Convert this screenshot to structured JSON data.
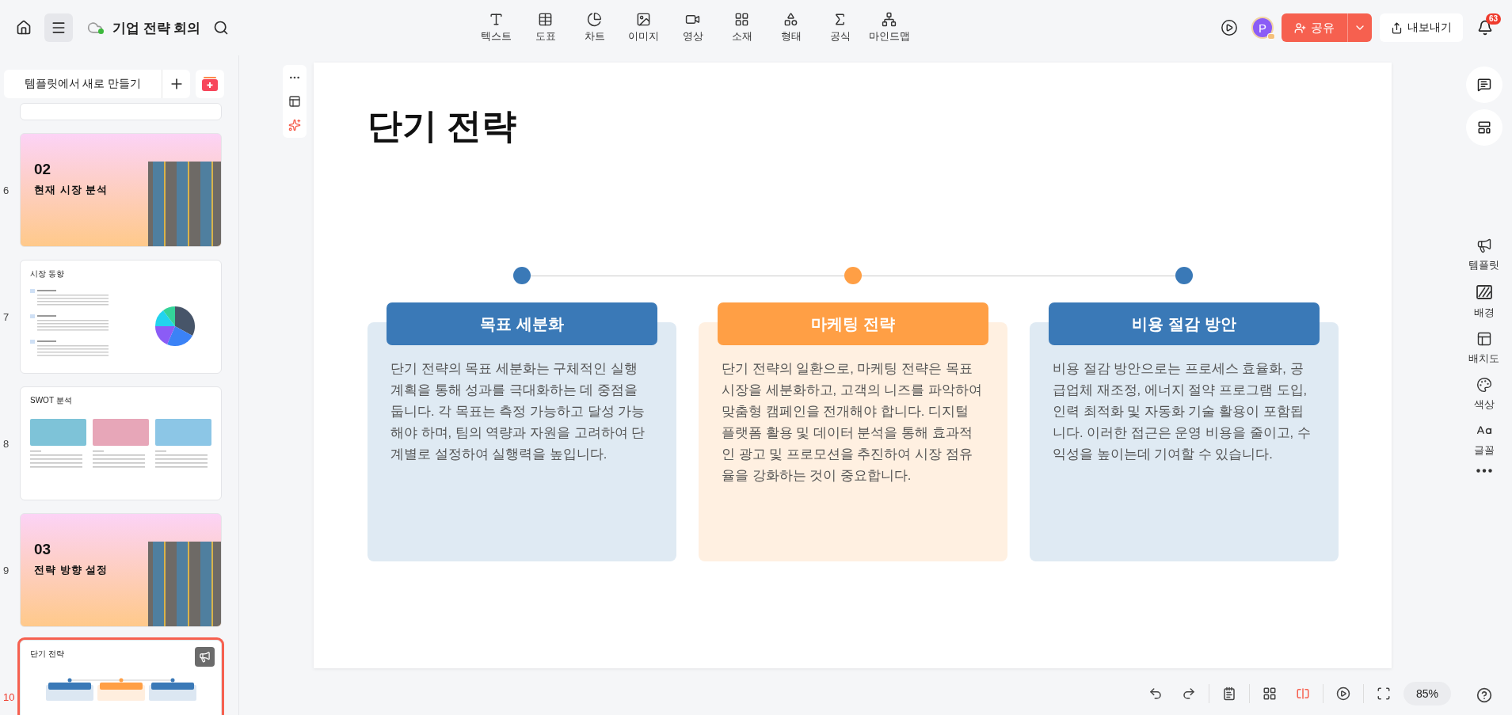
{
  "header": {
    "title": "기업 전략 회의",
    "tools": [
      {
        "label": "텍스트"
      },
      {
        "label": "도표"
      },
      {
        "label": "차트"
      },
      {
        "label": "이미지"
      },
      {
        "label": "영상"
      },
      {
        "label": "소재"
      },
      {
        "label": "형태"
      },
      {
        "label": "공식"
      },
      {
        "label": "마인드맵"
      }
    ],
    "avatar": "P",
    "share": "공유",
    "export": "내보내기",
    "notifications": "63"
  },
  "sidebar": {
    "new_from_template": "템플릿에서 새로 만들기",
    "slides": [
      {
        "kind": "partial",
        "selected": false
      },
      {
        "kind": "section",
        "number": "6",
        "section_number": "02",
        "title": "현재 시장 분석",
        "selected": false
      },
      {
        "kind": "chart",
        "number": "7",
        "title": "시장 동향",
        "selected": false
      },
      {
        "kind": "cards",
        "number": "8",
        "title": "SWOT 분석",
        "selected": false
      },
      {
        "kind": "section",
        "number": "9",
        "section_number": "03",
        "title": "전략 방향 설정",
        "selected": false
      },
      {
        "kind": "timeline",
        "number": "10",
        "title": "단기 전략",
        "selected": true
      }
    ]
  },
  "slide": {
    "title": "단기 전략",
    "columns": [
      {
        "heading": "목표 세분화",
        "color": "#3a79b7",
        "body": "단기 전략의 목표 세분화는 구체적인 실행 계획을 통해 성과를 극대화하는 데 중점을 둡니다. 각 목표는 측정 가능하고 달성 가능해야 하며, 팀의 역량과 자원을 고려하여 단계별로 설정하여 실행력을 높입니다."
      },
      {
        "heading": "마케팅 전략",
        "color": "#ff9f45",
        "body": "단기 전략의 일환으로, 마케팅 전략은 목표 시장을 세분화하고, 고객의 니즈를 파악하여 맞춤형 캠페인을 전개해야 합니다. 디지털 플랫폼 활용 및 데이터 분석을 통해 효과적인 광고 및 프로모션을 추진하여 시장 점유율을 강화하는 것이 중요합니다."
      },
      {
        "heading": "비용 절감 방안",
        "color": "#3a79b7",
        "body": "비용 절감 방안으로는 프로세스 효율화, 공급업체 재조정, 에너지 절약 프로그램 도입, 인력 최적화 및 자동화 기술 활용이 포함됩니다. 이러한 접근은 운영 비용을 줄이고, 수익성을 높이는데 기여할 수 있습니다."
      }
    ]
  },
  "right_rail": {
    "tools": [
      {
        "label": "템플릿"
      },
      {
        "label": "배경"
      },
      {
        "label": "배치도"
      },
      {
        "label": "색상"
      },
      {
        "label": "글꼴"
      }
    ]
  },
  "bottom_bar": {
    "views": [
      {
        "selected": false
      },
      {
        "selected": true
      }
    ],
    "zoom": "85%"
  }
}
